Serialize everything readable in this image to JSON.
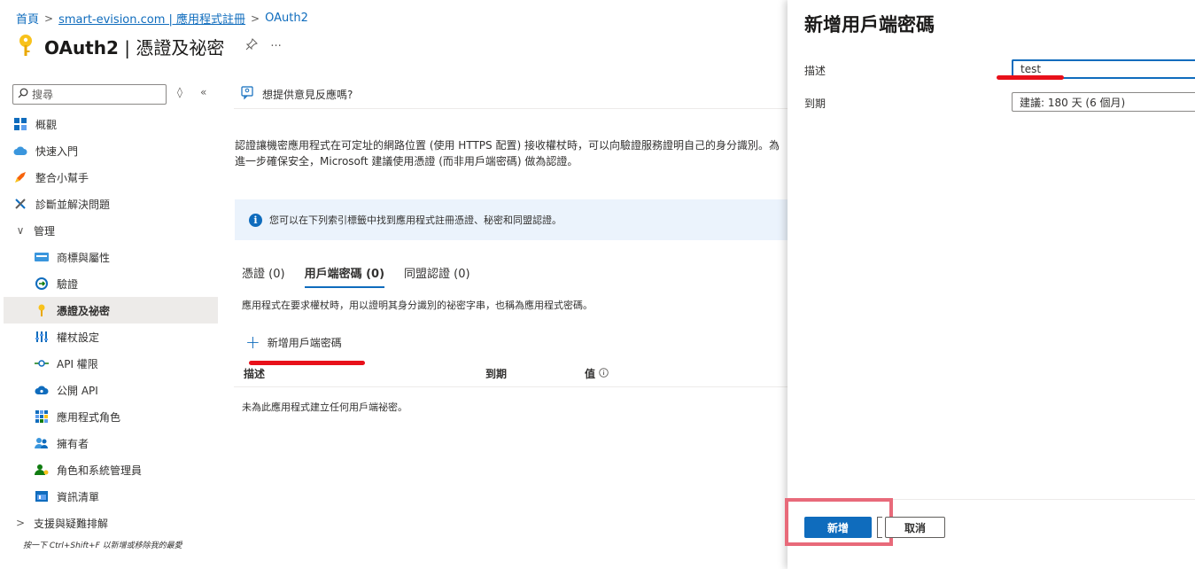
{
  "breadcrumb": {
    "home": "首頁",
    "app_registration": "smart-evision.com | 應用程式註冊",
    "current": "OAuth2"
  },
  "header": {
    "title_app": "OAuth2",
    "title_section": " | 憑證及祕密",
    "pin": "⚲",
    "more": "···"
  },
  "sidebar": {
    "search_placeholder": "搜尋",
    "items": [
      {
        "label": "概觀",
        "level": 0
      },
      {
        "label": "快速入門",
        "level": 0
      },
      {
        "label": "整合小幫手",
        "level": 0
      },
      {
        "label": "診斷並解決問題",
        "level": 0
      },
      {
        "label": "管理",
        "level": 0
      },
      {
        "label": "商標與屬性",
        "level": 1
      },
      {
        "label": "驗證",
        "level": 1
      },
      {
        "label": "憑證及祕密",
        "level": 1
      },
      {
        "label": "權杖設定",
        "level": 1
      },
      {
        "label": "API 權限",
        "level": 1
      },
      {
        "label": "公開 API",
        "level": 1
      },
      {
        "label": "應用程式角色",
        "level": 1
      },
      {
        "label": "擁有者",
        "level": 1
      },
      {
        "label": "角色和系統管理員",
        "level": 1
      },
      {
        "label": "資訊清單",
        "level": 1
      },
      {
        "label": "支援與疑難排解",
        "level": 0
      }
    ],
    "shortcut_hint": "按一下 Ctrl+Shift+F 以新增或移除我的最愛"
  },
  "main": {
    "feedback": "想提供意見反應嗎?",
    "description": "認證讓機密應用程式在可定址的網路位置 (使用 HTTPS 配置) 接收權杖時，可以向驗證服務證明自己的身分識別。為進一步確保安全，Microsoft 建議使用憑證 (而非用戶端密碼) 做為認證。",
    "info": "您可以在下列索引標籤中找到應用程式註冊憑證、秘密和同盟認證。",
    "tabs": [
      {
        "label": "憑證 (0)"
      },
      {
        "label": "用戶端密碼 (0)"
      },
      {
        "label": "同盟認證 (0)"
      }
    ],
    "tab_description": "應用程式在要求權杖時，用以證明其身分識別的祕密字串，也稱為應用程式密碼。",
    "add_secret": "新增用戶端密碼",
    "columns": {
      "description": "描述",
      "expires": "到期",
      "value": "值"
    },
    "empty": "未為此應用程式建立任何用戶端祕密。"
  },
  "panel": {
    "title": "新增用戶端密碼",
    "description_label": "描述",
    "description_value": "test",
    "expires_label": "到期",
    "expires_value": "建議: 180 天 (6 個月)",
    "add_button": "新增",
    "cancel_button": "取消"
  },
  "colors": {
    "accent": "#0f6cbd",
    "annotation_red": "#e8101a",
    "highlight_pink": "#e86a7a"
  }
}
